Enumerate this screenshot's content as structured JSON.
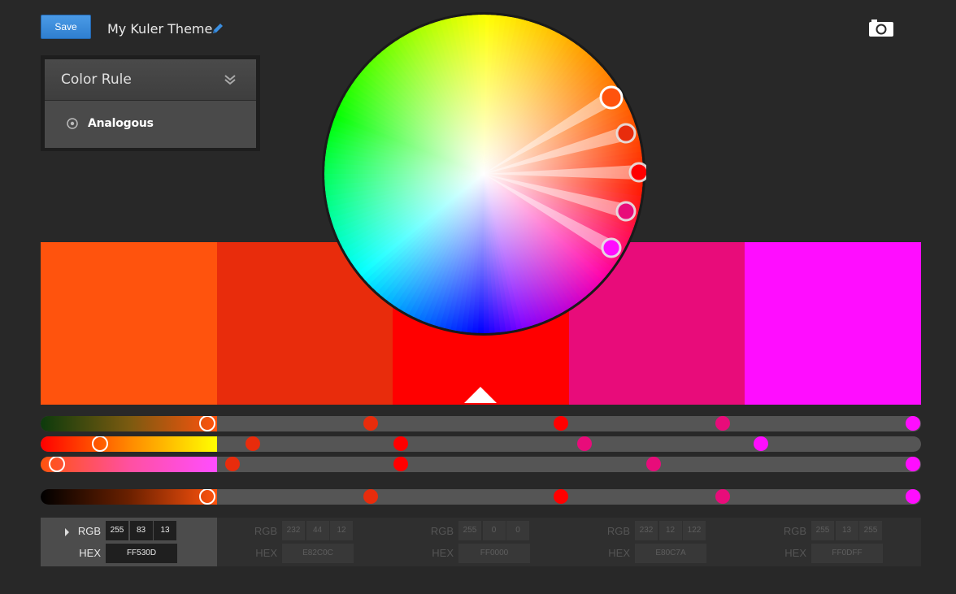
{
  "toolbar": {
    "save_label": "Save",
    "theme_title": "My Kuler Theme"
  },
  "icons": {
    "edit": "pencil-icon",
    "camera": "camera-icon",
    "collapse": "double-chevron-down-icon",
    "radio": "radio-icon"
  },
  "color_rule": {
    "title": "Color Rule",
    "selected": "Analogous"
  },
  "colors": {
    "accent": "#3a8ee0",
    "swatches": [
      "#FF530D",
      "#E82C0C",
      "#FF0000",
      "#E80C7A",
      "#FF0DFF"
    ]
  },
  "active_swatch": 0,
  "values": [
    {
      "rgb": [
        "255",
        "83",
        "13"
      ],
      "hex": "FF530D"
    },
    {
      "rgb": [
        "232",
        "44",
        "12"
      ],
      "hex": "E82C0C"
    },
    {
      "rgb": [
        "255",
        "0",
        "0"
      ],
      "hex": "FF0000"
    },
    {
      "rgb": [
        "232",
        "12",
        "122"
      ],
      "hex": "E80C7A"
    },
    {
      "rgb": [
        "255",
        "13",
        "255"
      ],
      "hex": "FF0DFF"
    }
  ],
  "labels": {
    "rgb": "RGB",
    "hex": "HEX"
  }
}
